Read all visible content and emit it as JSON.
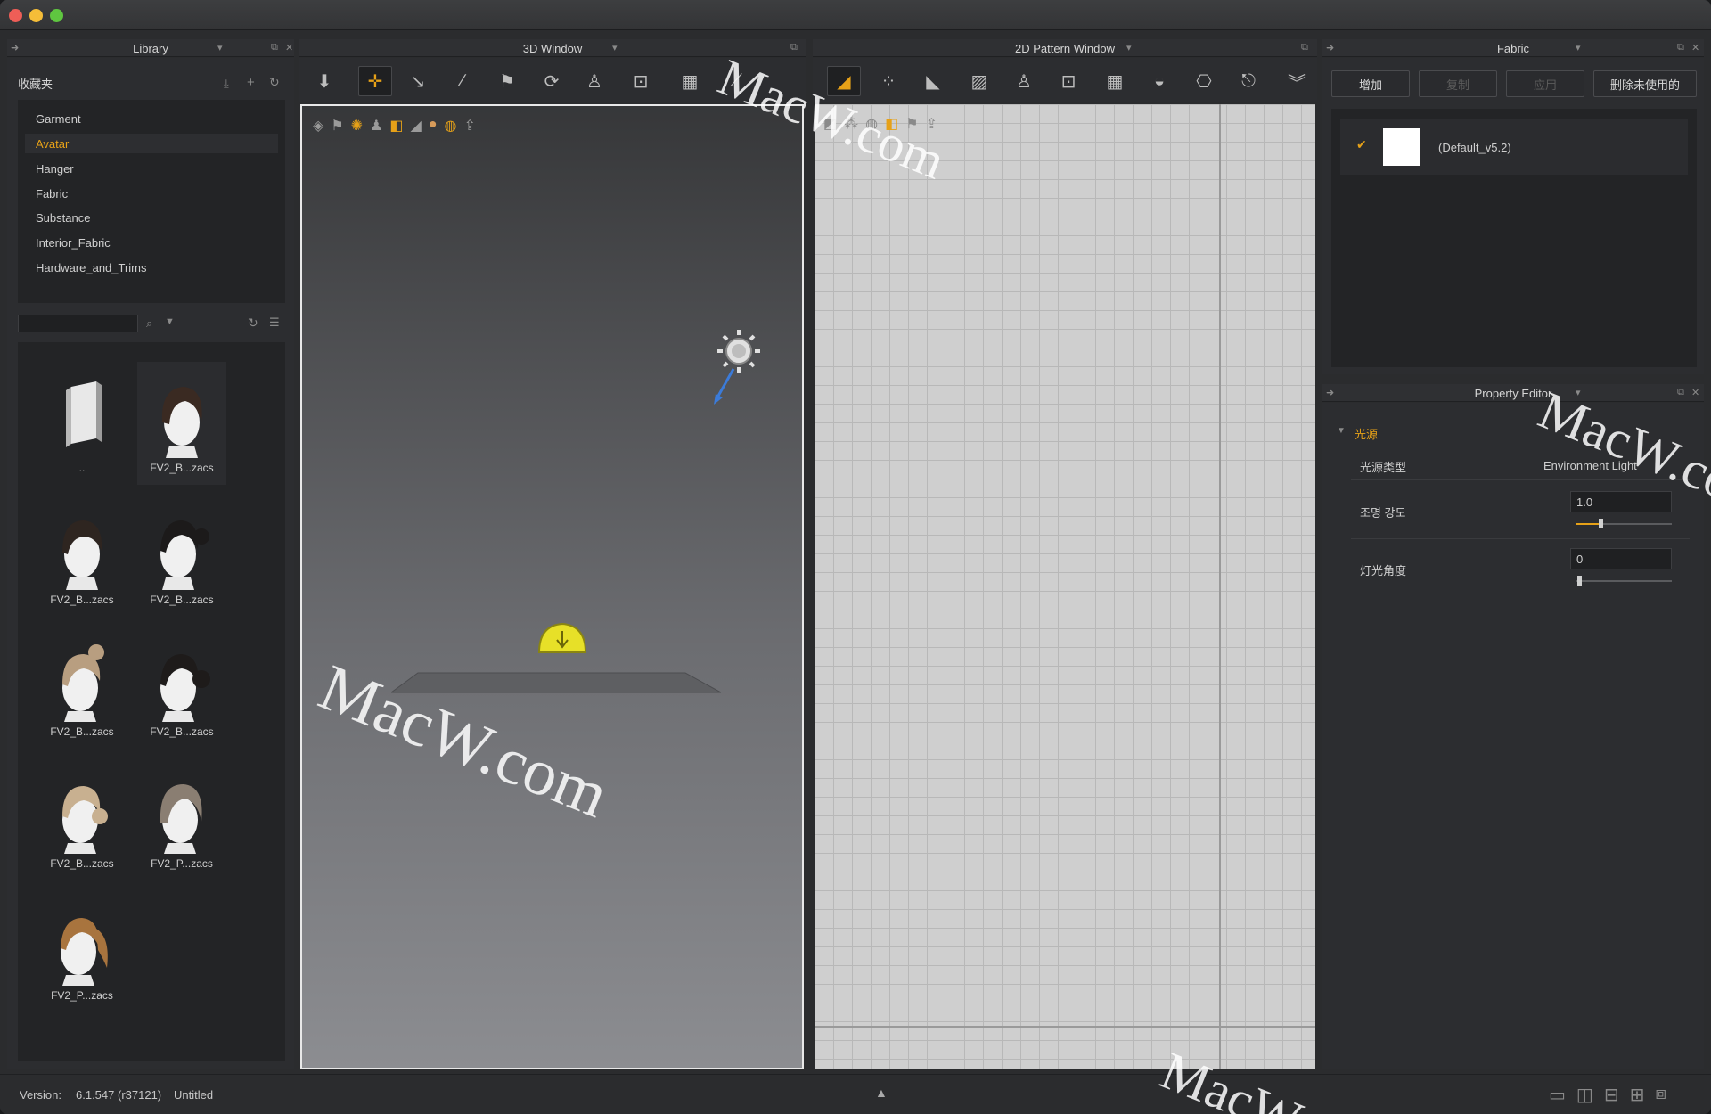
{
  "window": {
    "traffic": {
      "close_color": "#ee5e57",
      "min_color": "#f5bd38",
      "max_color": "#5fc640"
    }
  },
  "library": {
    "panel_title": "Library",
    "favorites_label": "收藏夹",
    "folders": [
      {
        "label": "Garment",
        "selected": false
      },
      {
        "label": "Avatar",
        "selected": true
      },
      {
        "label": "Hanger",
        "selected": false
      },
      {
        "label": "Fabric",
        "selected": false
      },
      {
        "label": "Substance",
        "selected": false
      },
      {
        "label": "Interior_Fabric",
        "selected": false
      },
      {
        "label": "Hardware_and_Trims",
        "selected": false
      }
    ],
    "search": {
      "value": "",
      "placeholder": ""
    },
    "items": [
      {
        "label": "..",
        "kind": "folder-up-icon"
      },
      {
        "label": "FV2_B...zacs",
        "kind": "hair-bob-icon"
      },
      {
        "label": "FV2_B...zacs",
        "kind": "hair-short-icon"
      },
      {
        "label": "FV2_B...zacs",
        "kind": "hair-bun-dark-icon"
      },
      {
        "label": "FV2_B...zacs",
        "kind": "hair-bun-blonde-icon"
      },
      {
        "label": "FV2_B...zacs",
        "kind": "hair-bun-black-icon"
      },
      {
        "label": "FV2_B...zacs",
        "kind": "hair-low-bun-icon"
      },
      {
        "label": "FV2_P...zacs",
        "kind": "hair-bob-ash-icon"
      },
      {
        "label": "FV2_P...zacs",
        "kind": "hair-ponytail-icon"
      }
    ]
  },
  "window3d": {
    "panel_title": "3D Window"
  },
  "window2d": {
    "panel_title": "2D Pattern Window"
  },
  "fabric": {
    "panel_title": "Fabric",
    "buttons": {
      "add": "增加",
      "copy": "复制",
      "apply": "应用",
      "delete_unused": "删除未使用的"
    },
    "items": [
      {
        "label": "(Default_v5.2)",
        "checked": true
      }
    ]
  },
  "property_editor": {
    "panel_title": "Property Editor",
    "section_title": "光源",
    "rows": {
      "type_label": "光源类型",
      "type_value": "Environment Light",
      "intensity_label": "조명 강도",
      "intensity_value": "1.0",
      "angle_label": "灯光角度",
      "angle_value": "0"
    }
  },
  "status": {
    "version_label": "Version:",
    "version_value": "6.1.547 (r37121)",
    "file_name": "Untitled"
  },
  "watermark": "MacW.com",
  "watermark_partial": "MacW"
}
